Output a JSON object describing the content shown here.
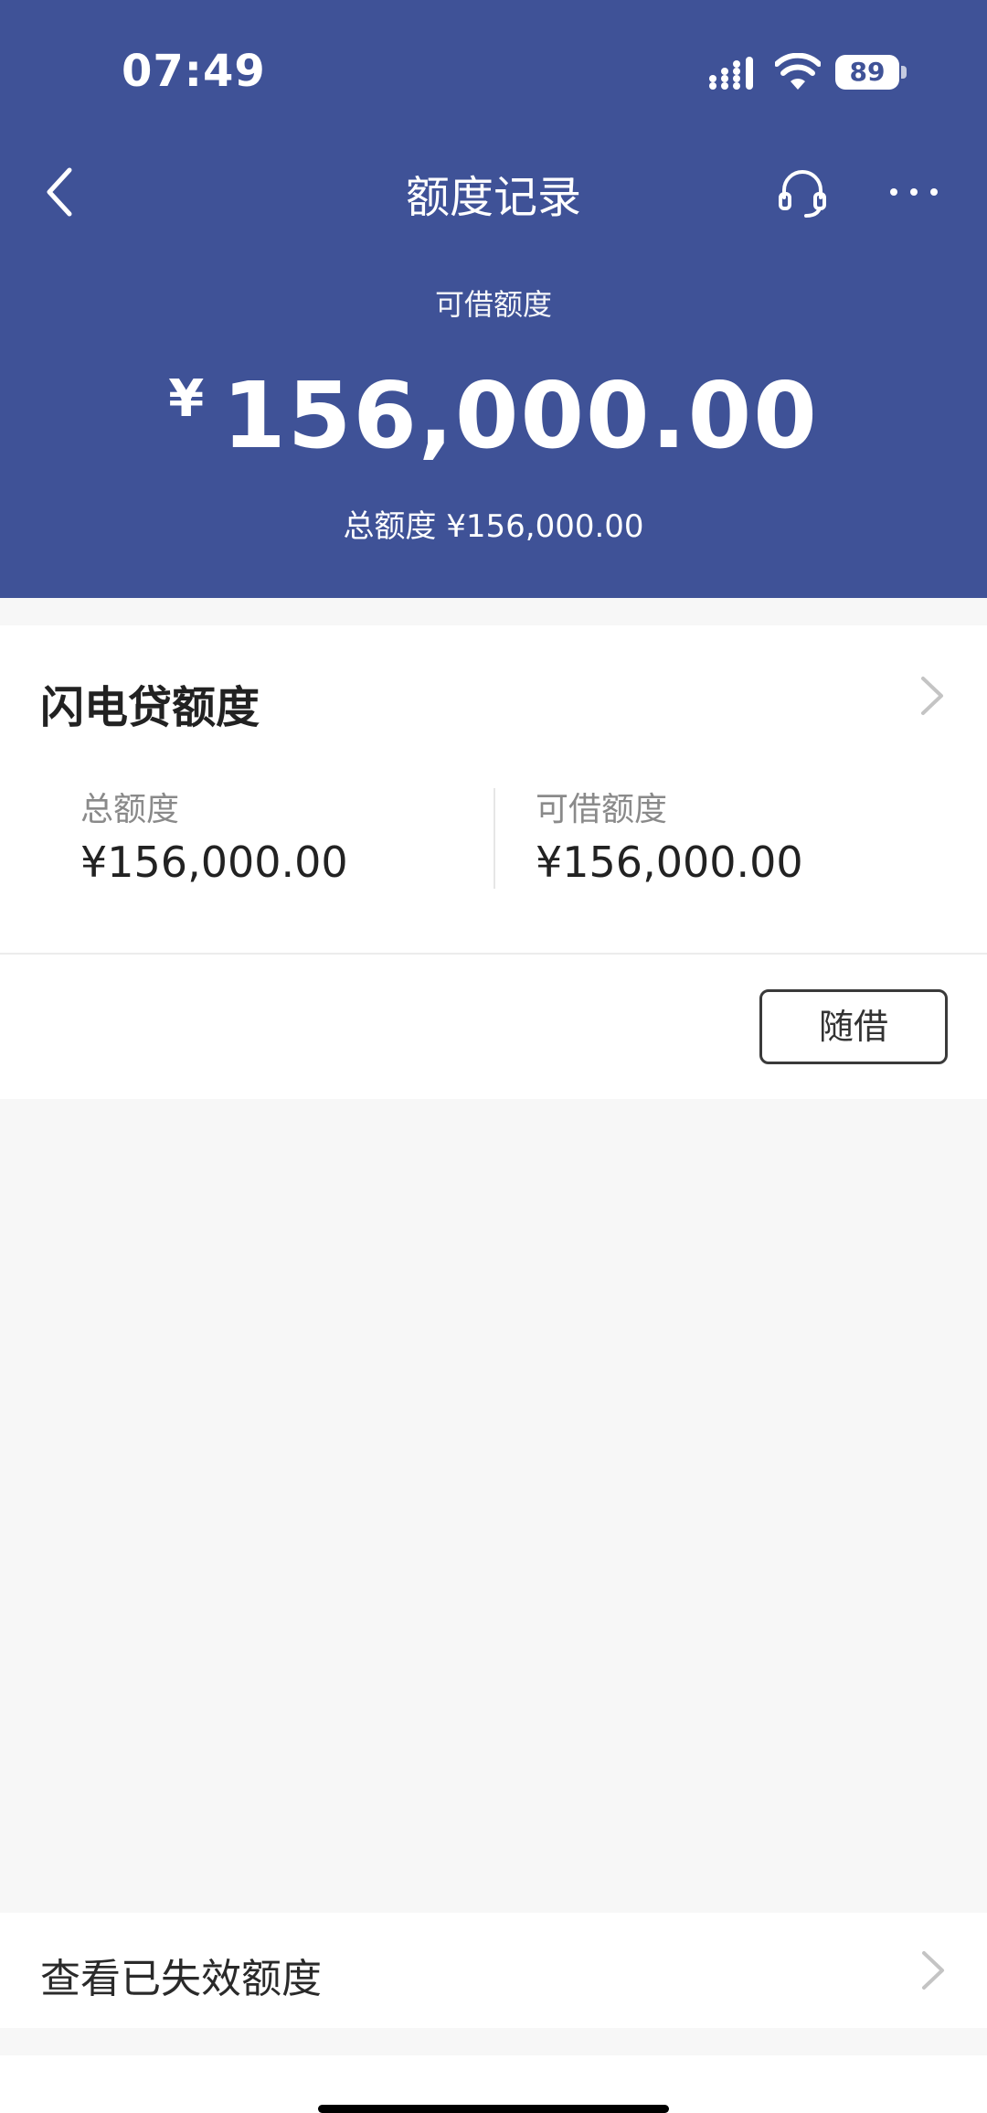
{
  "status_bar": {
    "time": "07:49",
    "battery": "89"
  },
  "nav": {
    "title": "额度记录"
  },
  "summary": {
    "available_label": "可借额度",
    "currency_symbol": "¥",
    "available_amount": "156,000.00",
    "total_label": "总额度",
    "total_value": "¥156,000.00"
  },
  "card": {
    "title": "闪电贷额度",
    "left_label": "总额度",
    "left_value": "¥156,000.00",
    "right_label": "可借额度",
    "right_value": "¥156,000.00",
    "action_label": "随借"
  },
  "expired": {
    "label": "查看已失效额度"
  },
  "colors": {
    "header_bg": "#3f5297",
    "page_bg": "#f7f7f7"
  }
}
